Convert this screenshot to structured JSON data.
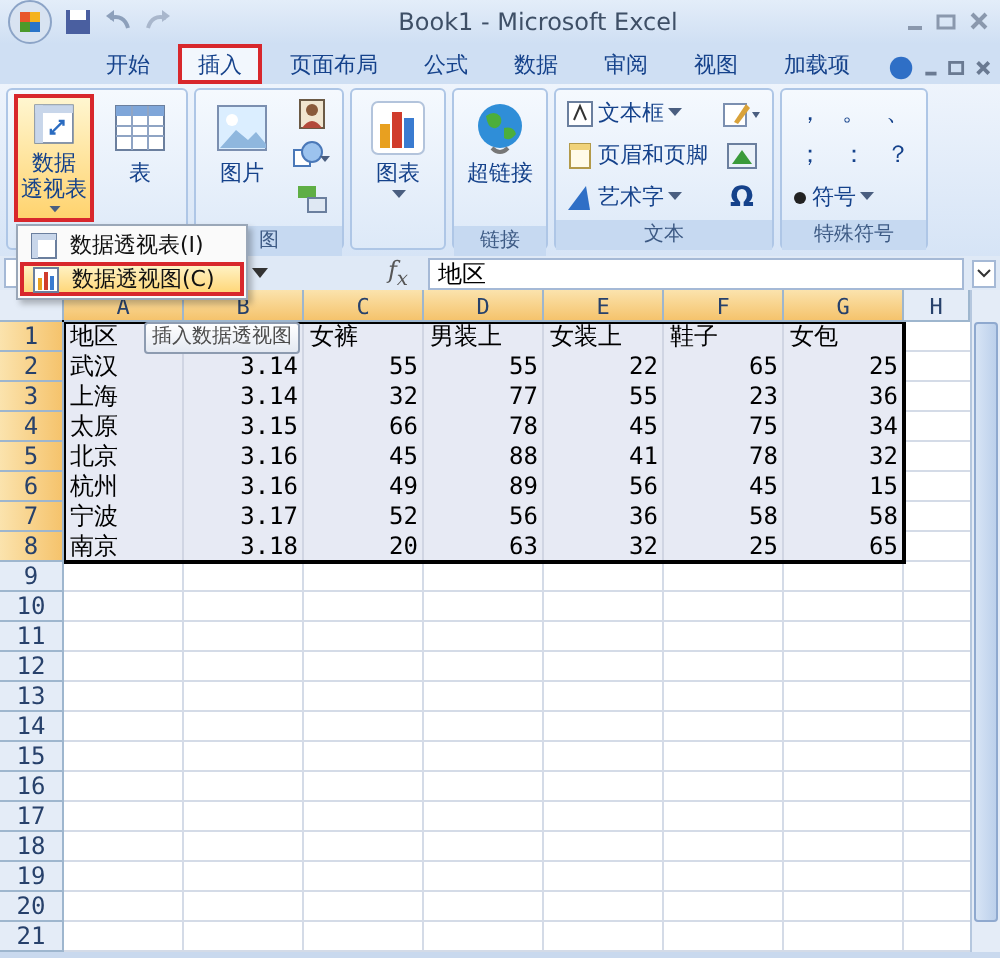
{
  "window": {
    "title": "Book1 - Microsoft Excel"
  },
  "tabs": [
    {
      "label": "开始",
      "selected": false
    },
    {
      "label": "插入",
      "selected": true
    },
    {
      "label": "页面布局",
      "selected": false
    },
    {
      "label": "公式",
      "selected": false
    },
    {
      "label": "数据",
      "selected": false
    },
    {
      "label": "审阅",
      "selected": false
    },
    {
      "label": "视图",
      "selected": false
    },
    {
      "label": "加载项",
      "selected": false
    }
  ],
  "ribbon": {
    "groups": [
      {
        "columns": [
          [
            {
              "kind": "large",
              "lines": [
                "数据",
                "透视表"
              ],
              "dropdown": true,
              "highlighted": true
            }
          ],
          [
            {
              "kind": "large",
              "lines": [
                "表"
              ],
              "dropdown": false,
              "highlighted": false
            }
          ]
        ]
      },
      {
        "label": "图",
        "columns": [
          [
            {
              "kind": "large",
              "lines": [
                "图片"
              ],
              "dropdown": false,
              "highlighted": false
            }
          ],
          [
            {
              "kind": "icon"
            },
            {
              "kind": "icon"
            },
            {
              "kind": "icon"
            }
          ]
        ]
      },
      {
        "columns": [
          [
            {
              "kind": "large",
              "lines": [
                "图表"
              ],
              "dropdown": true,
              "highlighted": false
            }
          ]
        ]
      },
      {
        "label": "链接",
        "columns": [
          [
            {
              "kind": "large",
              "lines": [
                "超链接"
              ],
              "dropdown": false,
              "highlighted": false
            }
          ]
        ]
      },
      {
        "label": "文本",
        "columns": [
          [
            {
              "kind": "small",
              "label": "文本框",
              "dropdown": true
            },
            {
              "kind": "small",
              "label": "页眉和页脚",
              "dropdown": false
            },
            {
              "kind": "small",
              "label": "艺术字",
              "dropdown": true
            }
          ],
          [
            {
              "kind": "icon"
            },
            {
              "kind": "icon"
            },
            {
              "kind": "glyph",
              "label": "Ω"
            }
          ]
        ]
      },
      {
        "label": "特殊符号",
        "columns": [
          [
            {
              "kind": "symbols",
              "chars": [
                "，",
                "。",
                "、",
                "；",
                "：",
                "？"
              ]
            },
            {
              "kind": "small",
              "label": "符号",
              "dropdown": true
            }
          ]
        ]
      }
    ]
  },
  "menu": {
    "items": [
      {
        "label": "数据透视表(I)",
        "selected": false
      },
      {
        "label": "数据透视图(C)",
        "selected": true
      }
    ]
  },
  "tooltip": {
    "text": "插入数据透视图"
  },
  "formula_bar": {
    "fx": "f$_{x}$",
    "value": "地区"
  },
  "sheet": {
    "columns": [
      {
        "label": "A",
        "selected": true
      },
      {
        "label": "B",
        "selected": true
      },
      {
        "label": "C",
        "selected": true
      },
      {
        "label": "D",
        "selected": true
      },
      {
        "label": "E",
        "selected": true
      },
      {
        "label": "F",
        "selected": true
      },
      {
        "label": "G",
        "selected": true
      },
      {
        "label": "H",
        "selected": false
      }
    ],
    "rows": [
      {
        "header": "1",
        "selected": true,
        "kind": "labels",
        "cells": [
          "地区",
          null,
          "女裤",
          "男装上",
          "女装上",
          "鞋子",
          "女包"
        ]
      },
      {
        "header": "2",
        "selected": true,
        "kind": "values",
        "cells": [
          "武汉",
          "3.14",
          "55",
          "55",
          "22",
          "65",
          "25"
        ]
      },
      {
        "header": "3",
        "selected": true,
        "kind": "values",
        "cells": [
          "上海",
          "3.14",
          "32",
          "77",
          "55",
          "23",
          "36"
        ]
      },
      {
        "header": "4",
        "selected": true,
        "kind": "values",
        "cells": [
          "太原",
          "3.15",
          "66",
          "78",
          "45",
          "75",
          "34"
        ]
      },
      {
        "header": "5",
        "selected": true,
        "kind": "values",
        "cells": [
          "北京",
          "3.16",
          "45",
          "88",
          "41",
          "78",
          "32"
        ]
      },
      {
        "header": "6",
        "selected": true,
        "kind": "values",
        "cells": [
          "杭州",
          "3.16",
          "49",
          "89",
          "56",
          "45",
          "15"
        ]
      },
      {
        "header": "7",
        "selected": true,
        "kind": "values",
        "cells": [
          "宁波",
          "3.17",
          "52",
          "56",
          "36",
          "58",
          "58"
        ]
      },
      {
        "header": "8",
        "selected": true,
        "kind": "values",
        "cells": [
          "南京",
          "3.18",
          "20",
          "63",
          "32",
          "25",
          "65"
        ]
      },
      {
        "header": "9",
        "selected": false
      },
      {
        "header": "10",
        "selected": false
      },
      {
        "header": "11",
        "selected": false
      },
      {
        "header": "12",
        "selected": false
      },
      {
        "header": "13",
        "selected": false
      },
      {
        "header": "14",
        "selected": false
      },
      {
        "header": "15",
        "selected": false
      },
      {
        "header": "16",
        "selected": false
      },
      {
        "header": "17",
        "selected": false
      },
      {
        "header": "18",
        "selected": false
      },
      {
        "header": "19",
        "selected": false
      },
      {
        "header": "20",
        "selected": false
      },
      {
        "header": "21",
        "selected": false
      }
    ]
  }
}
